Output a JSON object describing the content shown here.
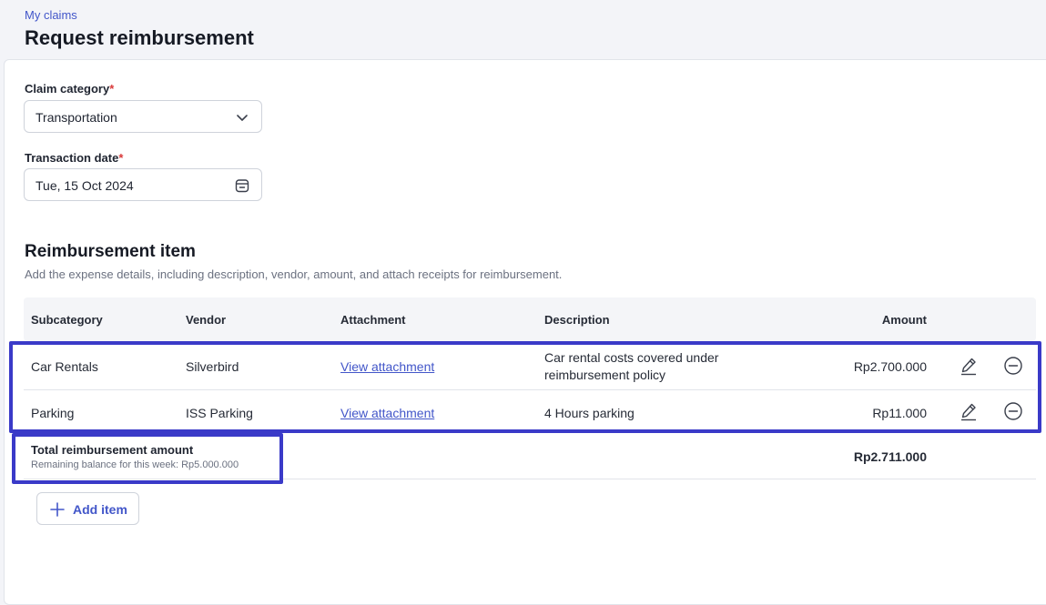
{
  "header": {
    "breadcrumb": "My claims",
    "title": "Request reimbursement"
  },
  "form": {
    "claim_category": {
      "label": "Claim category",
      "required_mark": "*",
      "value": "Transportation",
      "icon": "chevron-down-icon"
    },
    "transaction_date": {
      "label": "Transaction date",
      "required_mark": "*",
      "value": "Tue, 15 Oct 2024",
      "icon": "calendar-icon"
    }
  },
  "section": {
    "title": "Reimbursement item",
    "description": "Add the expense details, including description, vendor, amount, and attach receipts for reimbursement."
  },
  "table": {
    "columns": [
      "Subcategory",
      "Vendor",
      "Attachment",
      "Description",
      "Amount"
    ],
    "rows": [
      {
        "subcategory": "Car Rentals",
        "vendor": "Silverbird",
        "attachment": "View attachment",
        "description_line1": "Car rental costs covered under",
        "description_line2": "reimbursement policy",
        "amount": "Rp2.700.000"
      },
      {
        "subcategory": "Parking",
        "vendor": "ISS Parking",
        "attachment": "View attachment",
        "description": "4 Hours parking",
        "amount": "Rp11.000"
      }
    ],
    "row_action_icons": [
      "pencil-icon",
      "minus-circle-icon"
    ]
  },
  "total": {
    "label": "Total reimbursement amount",
    "remaining": "Remaining balance for this week: Rp5.000.000",
    "amount": "Rp2.711.000"
  },
  "add_item": {
    "label": "Add item",
    "icon": "plus-icon"
  },
  "colors": {
    "accent": "#4256c9",
    "highlight": "#3a3ac8",
    "required": "#d93a3a"
  }
}
